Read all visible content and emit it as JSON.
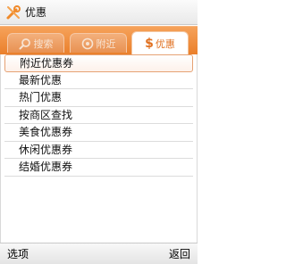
{
  "app": {
    "title": "优惠",
    "icon": "tools-icon"
  },
  "tabs": [
    {
      "label": "搜索",
      "icon": "search-icon",
      "active": false
    },
    {
      "label": "附近",
      "icon": "location-icon",
      "active": false
    },
    {
      "label": "优惠",
      "icon": "dollar-icon",
      "icon_text": "$",
      "active": true
    }
  ],
  "menu": {
    "items": [
      "附近优惠券",
      "最新优惠",
      "热门优惠",
      "按商区查找",
      "美食优惠券",
      "休闲优惠券",
      "结婚优惠券"
    ],
    "selected_index": 0
  },
  "softkeys": {
    "left": "选项",
    "right": "返回"
  },
  "colors": {
    "accent": "#ea7f2b",
    "selected_border": "#e6a274"
  }
}
